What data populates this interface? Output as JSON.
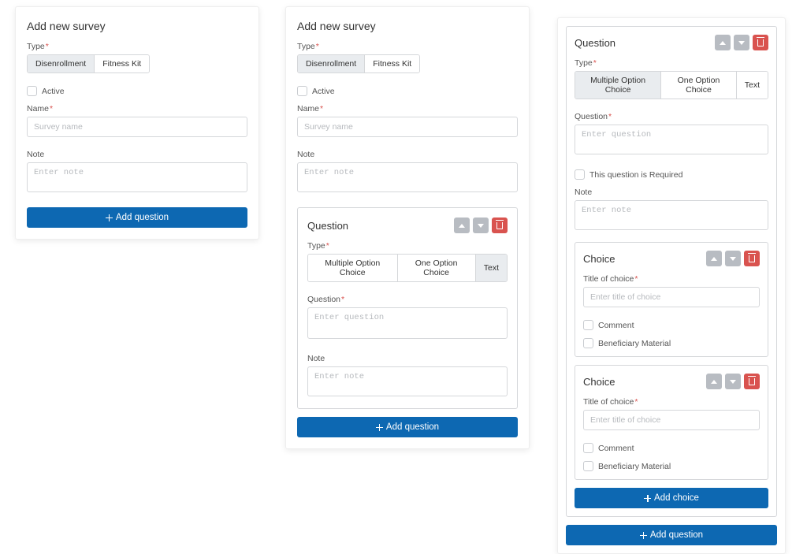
{
  "colors": {
    "primary": "#0d68b2",
    "danger": "#d9534f"
  },
  "p1": {
    "title": "Add new survey",
    "type_label": "Type",
    "type_opts": [
      "Disenrollment",
      "Fitness Kit"
    ],
    "type_selected": 0,
    "active_label": "Active",
    "name_label": "Name",
    "name_ph": "Survey name",
    "note_label": "Note",
    "note_ph": "Enter note",
    "add_q": "Add question"
  },
  "p2": {
    "title": "Add new survey",
    "type_label": "Type",
    "type_opts": [
      "Disenrollment",
      "Fitness Kit"
    ],
    "type_selected": 0,
    "active_label": "Active",
    "name_label": "Name",
    "name_ph": "Survey name",
    "note_label": "Note",
    "note_ph": "Enter note",
    "question": {
      "title": "Question",
      "type_label": "Type",
      "type_opts": [
        "Multiple Option Choice",
        "One Option Choice",
        "Text"
      ],
      "type_selected": 2,
      "q_label": "Question",
      "q_ph": "Enter question",
      "note_label": "Note",
      "note_ph": "Enter note"
    },
    "add_q": "Add question"
  },
  "p3": {
    "question": {
      "title": "Question",
      "type_label": "Type",
      "type_opts": [
        "Multiple Option Choice",
        "One Option Choice",
        "Text"
      ],
      "type_selected": 0,
      "q_label": "Question",
      "q_ph": "Enter question",
      "required_label": "This question is Required",
      "note_label": "Note",
      "note_ph": "Enter note"
    },
    "choice": {
      "title": "Choice",
      "title_label": "Title of choice",
      "title_ph": "Enter title of choice",
      "comment_label": "Comment",
      "benef_label": "Beneficiary Material"
    },
    "add_choice": "Add choice",
    "add_q": "Add question"
  }
}
